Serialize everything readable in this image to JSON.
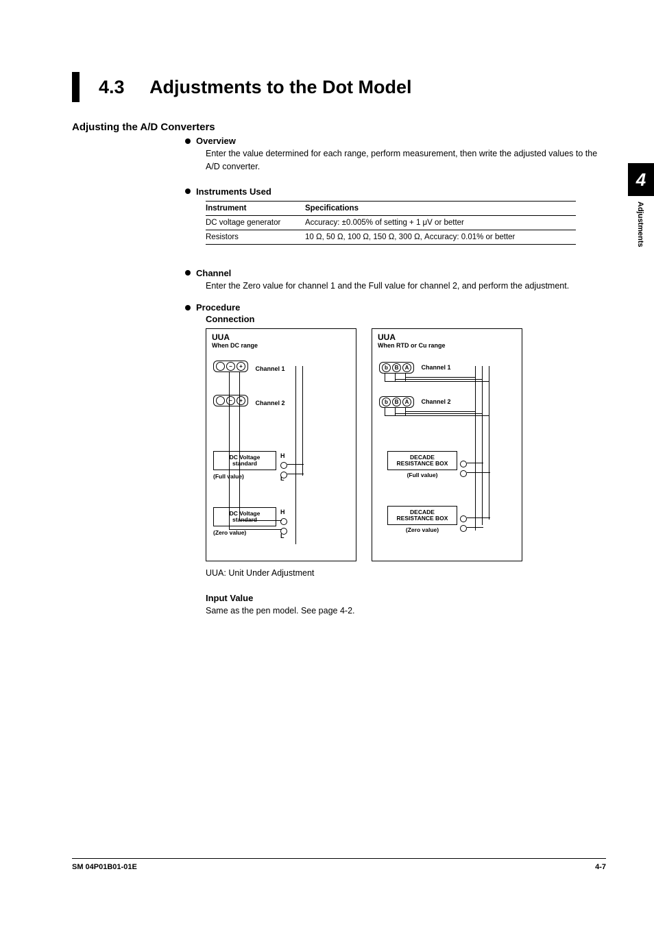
{
  "section": {
    "number": "4.3",
    "title": "Adjustments to the Dot Model"
  },
  "h2": "Adjusting the A/D Converters",
  "overview": {
    "label": "Overview",
    "text": "Enter the value determined for each range, perform measurement, then write the adjusted values to the A/D converter."
  },
  "instruments": {
    "label": "Instruments Used",
    "headers": {
      "c1": "Instrument",
      "c2": "Specifications"
    },
    "rows": [
      {
        "c1": "DC voltage generator",
        "c2": "Accuracy: ±0.005% of setting + 1 μV or better"
      },
      {
        "c1": "Resistors",
        "c2": "10 Ω, 50 Ω, 100 Ω, 150 Ω, 300 Ω, Accuracy: 0.01% or better"
      }
    ]
  },
  "channel": {
    "label": "Channel",
    "text": "Enter the Zero value for channel 1 and the Full value for channel 2, and perform the adjustment."
  },
  "procedure": {
    "label": "Procedure",
    "connection_label": "Connection",
    "uua_caption": "UUA: Unit Under Adjustment",
    "input_value_label": "Input Value",
    "input_value_text": "Same as the pen model.  See page 4-2.",
    "dc_diag": {
      "uua": "UUA",
      "when": "When DC range",
      "ch1": "Channel 1",
      "ch2": "Channel 2",
      "pin_minus": "–",
      "pin_plus": "+",
      "src_name": "DC Voltage standard",
      "full": "(Full value)",
      "zero": "(Zero value)",
      "H": "H",
      "L": "L"
    },
    "rtd_diag": {
      "uua": "UUA",
      "when": "When RTD or Cu range",
      "ch1": "Channel 1",
      "ch2": "Channel 2",
      "pin_b": "b",
      "pin_B": "B",
      "pin_A": "A",
      "src_name": "DECADE RESISTANCE BOX",
      "full": "(Full value)",
      "zero": "(Zero value)"
    }
  },
  "side_tab": {
    "number": "4",
    "label": "Adjustments"
  },
  "footer": {
    "left": "SM 04P01B01-01E",
    "right": "4-7"
  }
}
